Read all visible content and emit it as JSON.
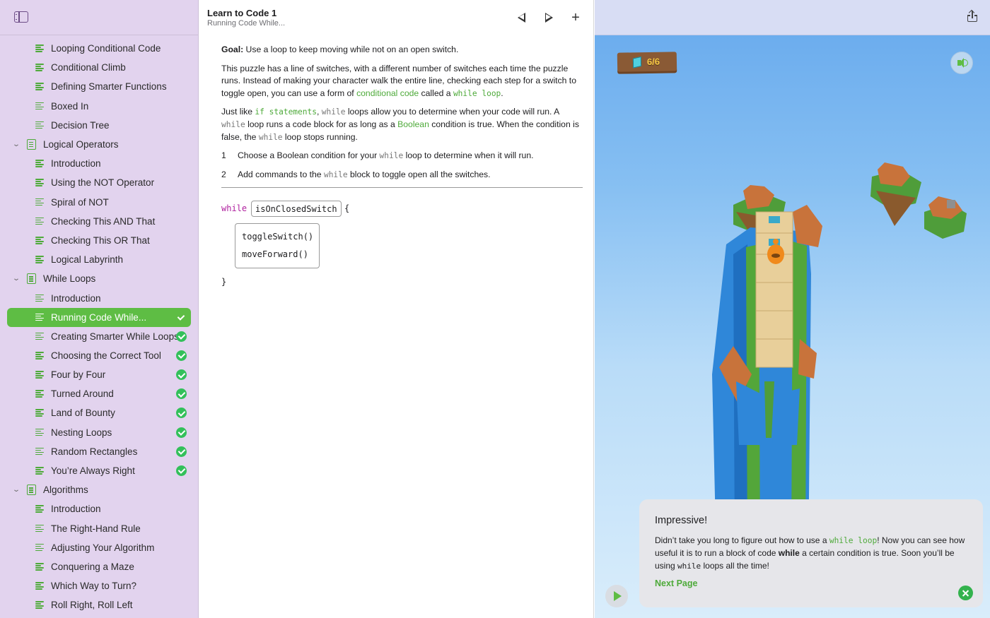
{
  "sidebar": {
    "items": [
      {
        "type": "page",
        "label": "Looping Conditional Code"
      },
      {
        "type": "page",
        "label": "Conditional Climb"
      },
      {
        "type": "page",
        "label": "Defining Smarter Functions"
      },
      {
        "type": "page",
        "label": "Boxed In"
      },
      {
        "type": "page",
        "label": "Decision Tree"
      },
      {
        "type": "chapter",
        "label": "Logical Operators"
      },
      {
        "type": "page",
        "label": "Introduction"
      },
      {
        "type": "page",
        "label": "Using the NOT Operator"
      },
      {
        "type": "page",
        "label": "Spiral of NOT"
      },
      {
        "type": "page",
        "label": "Checking This AND That"
      },
      {
        "type": "page",
        "label": "Checking This OR That"
      },
      {
        "type": "page",
        "label": "Logical Labyrinth"
      },
      {
        "type": "chapter",
        "label": "While Loops"
      },
      {
        "type": "page",
        "label": "Introduction"
      },
      {
        "type": "page",
        "label": "Running Code While...",
        "selected": true,
        "completed": true
      },
      {
        "type": "page",
        "label": "Creating Smarter While Loops",
        "completed": true
      },
      {
        "type": "page",
        "label": "Choosing the Correct Tool",
        "completed": true
      },
      {
        "type": "page",
        "label": "Four by Four",
        "completed": true
      },
      {
        "type": "page",
        "label": "Turned Around",
        "completed": true
      },
      {
        "type": "page",
        "label": "Land of Bounty",
        "completed": true
      },
      {
        "type": "page",
        "label": "Nesting Loops",
        "completed": true
      },
      {
        "type": "page",
        "label": "Random Rectangles",
        "completed": true
      },
      {
        "type": "page",
        "label": "You’re Always Right",
        "completed": true
      },
      {
        "type": "chapter",
        "label": "Algorithms"
      },
      {
        "type": "page",
        "label": "Introduction"
      },
      {
        "type": "page",
        "label": "The Right-Hand Rule"
      },
      {
        "type": "page",
        "label": "Adjusting Your Algorithm"
      },
      {
        "type": "page",
        "label": "Conquering a Maze"
      },
      {
        "type": "page",
        "label": "Which Way to Turn?"
      },
      {
        "type": "page",
        "label": "Roll Right, Roll Left"
      }
    ]
  },
  "header": {
    "title": "Learn to Code 1",
    "subtitle": "Running Code While..."
  },
  "content": {
    "goal_label": "Goal:",
    "goal_text": " Use a loop to keep moving while not on an open switch.",
    "p1_a": "This puzzle has a line of switches, with a different number of switches each time the puzzle runs. Instead of making your character walk the entire line, checking each step for a switch to toggle open, you can use a form of ",
    "p1_link1": "conditional code",
    "p1_b": " called a ",
    "p1_link2": "while loop",
    "p1_c": ".",
    "p2_a": "Just like ",
    "p2_link1": "if statements",
    "p2_b": ", ",
    "p2_code1": "while",
    "p2_c": " loops allow you to determine when your code will run. A ",
    "p2_code2": "while",
    "p2_d": " loop runs a code block for as long as a ",
    "p2_link2": "Boolean",
    "p2_e": " condition is true. When the condition is false, the ",
    "p2_code3": "while",
    "p2_f": " loop stops running.",
    "step1_num": "1",
    "step1_a": "Choose a Boolean condition for your ",
    "step1_code": "while",
    "step1_b": " loop to determine when it will run.",
    "step2_num": "2",
    "step2_a": "Add commands to the ",
    "step2_code": "while",
    "step2_b": " block to toggle open all the switches."
  },
  "code": {
    "keyword": "while",
    "condition": "isOnClosedSwitch",
    "open_brace": "{",
    "line1": "toggleSwitch()",
    "line2": "moveForward()",
    "close_brace": "}"
  },
  "live": {
    "gems_collected": "6",
    "gems_separator": "/",
    "gems_total": "6",
    "accent": "#5ebd44",
    "toast": {
      "title": "Impressive!",
      "body_a": "Didn’t take you long to figure out how to use a ",
      "body_link": "while loop",
      "body_b": "! Now you can see how useful it is to run a block of code ",
      "body_bold": "while",
      "body_c": " a certain condition is true. Soon you’ll be using ",
      "body_code": "while",
      "body_d": " loops all the time!",
      "next_label": "Next Page"
    }
  }
}
